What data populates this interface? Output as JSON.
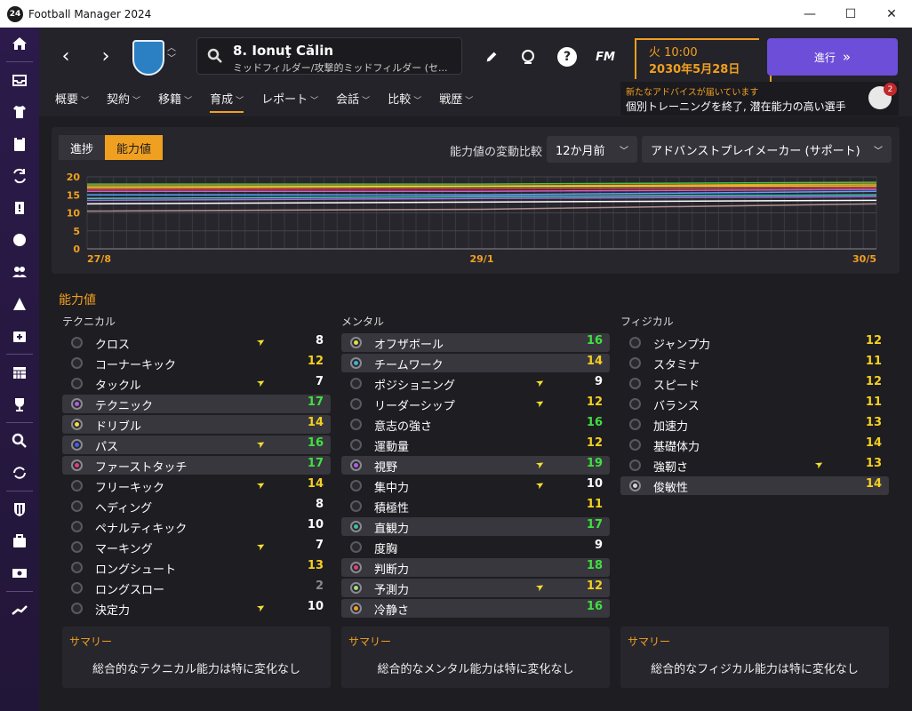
{
  "app": {
    "title": "Football Manager 2024",
    "icon_text": "24"
  },
  "window_controls": {
    "minimize": "—",
    "maximize": "☐",
    "close": "✕"
  },
  "player": {
    "name": "8. Ionuţ Călin",
    "position": "ミッドフィルダー/攻撃的ミッドフィルダー (セ..."
  },
  "header": {
    "day_time": "火 10:00",
    "date": "2030年5月28日",
    "continue_label": "進行",
    "continue_icon": "»",
    "fm_logo": "FM",
    "help": "?"
  },
  "advice": {
    "title": "新たなアドバイスが届いています",
    "text": "個別トレーニングを終了, 潜在能力の高い選手",
    "badge": "2"
  },
  "tabs": [
    "概要",
    "契約",
    "移籍",
    "育成",
    "レポート",
    "会話",
    "比較",
    "戦歴"
  ],
  "active_tab": "育成",
  "view_toggle": {
    "progress": "進捗",
    "attributes": "能力値"
  },
  "compare": {
    "label": "能力値の変動比較",
    "period": "12か月前",
    "role": "アドバンストプレイメーカー (サポート)"
  },
  "chart_data": {
    "type": "line",
    "x_labels": [
      "27/8",
      "29/1",
      "30/5"
    ],
    "y_ticks": [
      0,
      5,
      10,
      15,
      20
    ],
    "ylim": [
      0,
      20
    ],
    "grid": true,
    "series": [
      {
        "color": "#4fc040",
        "values": [
          18,
          18,
          18.5
        ]
      },
      {
        "color": "#f0a020",
        "values": [
          17.5,
          17.5,
          18
        ]
      },
      {
        "color": "#e8e040",
        "values": [
          17,
          17.3,
          17.5
        ]
      },
      {
        "color": "#e04040",
        "values": [
          16.5,
          16.7,
          17
        ]
      },
      {
        "color": "#d060c0",
        "values": [
          16,
          16,
          16.5
        ]
      },
      {
        "color": "#60a0ff",
        "values": [
          15,
          15,
          16
        ]
      },
      {
        "color": "#40c8c0",
        "values": [
          14,
          14.5,
          15
        ]
      },
      {
        "color": "#a070e0",
        "values": [
          13.5,
          14,
          14.5
        ]
      },
      {
        "color": "#ffffff",
        "values": [
          12.5,
          13,
          13.5
        ]
      },
      {
        "color": "#b09090",
        "values": [
          10.5,
          11,
          12.5
        ]
      }
    ]
  },
  "attributes_title": "能力値",
  "columns": [
    {
      "title": "テクニカル",
      "rows": [
        {
          "name": "クロス",
          "value": "8",
          "hl": false,
          "arrow": true,
          "dot": ""
        },
        {
          "name": "コーナーキック",
          "value": "12",
          "hl": false,
          "arrow": false,
          "dot": ""
        },
        {
          "name": "タックル",
          "value": "7",
          "hl": false,
          "arrow": true,
          "dot": ""
        },
        {
          "name": "テクニック",
          "value": "17",
          "hl": true,
          "arrow": false,
          "dot": "#b060e0"
        },
        {
          "name": "ドリブル",
          "value": "14",
          "hl": true,
          "arrow": false,
          "dot": "#f0e040"
        },
        {
          "name": "パス",
          "value": "16",
          "hl": true,
          "arrow": true,
          "dot": "#4060e0"
        },
        {
          "name": "ファーストタッチ",
          "value": "17",
          "hl": true,
          "arrow": false,
          "dot": "#e04080"
        },
        {
          "name": "フリーキック",
          "value": "14",
          "hl": false,
          "arrow": true,
          "dot": ""
        },
        {
          "name": "ヘディング",
          "value": "8",
          "hl": false,
          "arrow": false,
          "dot": ""
        },
        {
          "name": "ペナルティキック",
          "value": "10",
          "hl": false,
          "arrow": false,
          "dot": ""
        },
        {
          "name": "マーキング",
          "value": "7",
          "hl": false,
          "arrow": true,
          "dot": ""
        },
        {
          "name": "ロングシュート",
          "value": "13",
          "hl": false,
          "arrow": false,
          "dot": ""
        },
        {
          "name": "ロングスロー",
          "value": "2",
          "hl": false,
          "arrow": false,
          "dot": ""
        },
        {
          "name": "決定力",
          "value": "10",
          "hl": false,
          "arrow": true,
          "dot": ""
        }
      ],
      "summary_title": "サマリー",
      "summary": "総合的なテクニカル能力は特に変化なし"
    },
    {
      "title": "メンタル",
      "rows": [
        {
          "name": "オフザボール",
          "value": "16",
          "hl": true,
          "arrow": false,
          "dot": "#e0e040"
        },
        {
          "name": "チームワーク",
          "value": "14",
          "hl": true,
          "arrow": false,
          "dot": "#40b0d0"
        },
        {
          "name": "ポジショニング",
          "value": "9",
          "hl": false,
          "arrow": true,
          "dot": ""
        },
        {
          "name": "リーダーシップ",
          "value": "12",
          "hl": false,
          "arrow": true,
          "dot": ""
        },
        {
          "name": "意志の強さ",
          "value": "16",
          "hl": false,
          "arrow": false,
          "dot": ""
        },
        {
          "name": "運動量",
          "value": "12",
          "hl": false,
          "arrow": false,
          "dot": ""
        },
        {
          "name": "視野",
          "value": "19",
          "hl": true,
          "arrow": true,
          "dot": "#b060e0"
        },
        {
          "name": "集中力",
          "value": "10",
          "hl": false,
          "arrow": true,
          "dot": ""
        },
        {
          "name": "積極性",
          "value": "11",
          "hl": false,
          "arrow": false,
          "dot": ""
        },
        {
          "name": "直観力",
          "value": "17",
          "hl": true,
          "arrow": false,
          "dot": "#40c0a0"
        },
        {
          "name": "度胸",
          "value": "9",
          "hl": false,
          "arrow": false,
          "dot": ""
        },
        {
          "name": "判断力",
          "value": "18",
          "hl": true,
          "arrow": false,
          "dot": "#e04080"
        },
        {
          "name": "予測力",
          "value": "12",
          "hl": true,
          "arrow": true,
          "dot": "#a0e080"
        },
        {
          "name": "冷静さ",
          "value": "16",
          "hl": true,
          "arrow": false,
          "dot": "#f0a020"
        }
      ],
      "summary_title": "サマリー",
      "summary": "総合的なメンタル能力は特に変化なし"
    },
    {
      "title": "フィジカル",
      "rows": [
        {
          "name": "ジャンプ力",
          "value": "12",
          "hl": false,
          "arrow": false,
          "dot": ""
        },
        {
          "name": "スタミナ",
          "value": "11",
          "hl": false,
          "arrow": false,
          "dot": ""
        },
        {
          "name": "スピード",
          "value": "12",
          "hl": false,
          "arrow": false,
          "dot": ""
        },
        {
          "name": "バランス",
          "value": "11",
          "hl": false,
          "arrow": false,
          "dot": ""
        },
        {
          "name": "加速力",
          "value": "13",
          "hl": false,
          "arrow": false,
          "dot": ""
        },
        {
          "name": "基礎体力",
          "value": "14",
          "hl": false,
          "arrow": false,
          "dot": ""
        },
        {
          "name": "強靭さ",
          "value": "13",
          "hl": false,
          "arrow": true,
          "dot": ""
        },
        {
          "name": "俊敏性",
          "value": "14",
          "hl": true,
          "arrow": false,
          "dot": "#d0d0d0"
        }
      ],
      "summary_title": "サマリー",
      "summary": "総合的なフィジカル能力は特に変化なし"
    }
  ],
  "value_colors": {
    "low": "#cfcfcf",
    "mid": "#ffffff",
    "good": "#f5d020",
    "great": "#40e040",
    "poor": "#8a8a8a"
  },
  "nav_icons": [
    "home-icon",
    "inbox-icon",
    "squad-icon",
    "tactics-icon",
    "transfer-icon",
    "report-icon",
    "ball-icon",
    "staff-icon",
    "training-icon",
    "medical-icon",
    "calendar-icon",
    "trophy-icon",
    "search-icon",
    "refresh-icon",
    "club-icon",
    "finance-icon",
    "money-icon",
    "trend-icon"
  ]
}
